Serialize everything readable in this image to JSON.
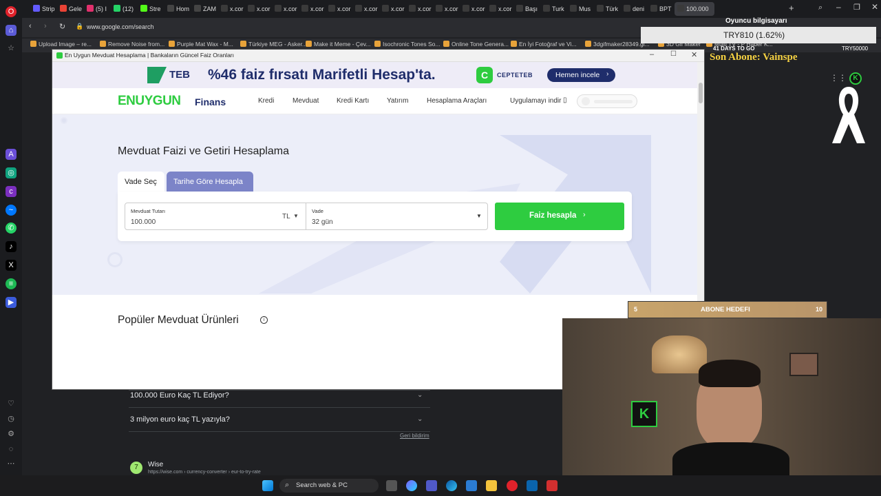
{
  "browser": {
    "tabs": [
      "Strip",
      "Gele",
      "(5) I",
      "(12)",
      "Stre",
      "Hom",
      "ZAM",
      "x.cor",
      "x.cor",
      "x.cor",
      "x.cor",
      "x.cor",
      "x.cor",
      "x.cor",
      "x.cor",
      "x.cor",
      "x.cor",
      "x.cor",
      "Başı",
      "Turk",
      "Mus",
      "Türk",
      "deni",
      "BPT",
      "100.000"
    ],
    "url": "www.google.com/search",
    "bookmarks": [
      "Upload Image – re...",
      "Remove Noise from...",
      "Purple Mat Wax - M...",
      "Türkiye MEG - Asker...",
      "Make it Meme - Çev...",
      "Isochronic Tones So...",
      "Online Tone Genera...",
      "En İyi Fotoğraf ve Vi...",
      "3dgifmaker28349.gi...",
      "3D Gif Maker",
      "Multi TV - P Haber K..."
    ]
  },
  "popup": {
    "title": "En Uygun Mevduat Hesaplama | Bankaların Güncel Faiz Oranları",
    "banner": {
      "bank": "TEB",
      "text": "%46 faiz fırsatı Marifetli Hesap'ta.",
      "brand": "CEPTETEB",
      "cta": "Hemen incele"
    },
    "nav": {
      "logo_main": "ENUYGUN",
      "logo_sub": "Finans",
      "links": [
        "Kredi",
        "Mevduat",
        "Kredi Kartı",
        "Yatırım",
        "Hesaplama Araçları"
      ],
      "app": "Uygulamayı indir"
    },
    "hero": {
      "title": "Mevduat Faizi ve Getiri Hesaplama",
      "tab_active": "Vade Seç",
      "tab_other": "Tarihe Göre Hesapla",
      "amount_label": "Mevduat Tutarı",
      "amount_value": "100.000",
      "currency": "TL",
      "term_label": "Vade",
      "term_value": "32 gün",
      "button": "Faiz hesapla"
    },
    "popular_title": "Popüler Mevduat Ürünleri"
  },
  "google": {
    "faq": [
      "100.000 Euro Kaç TL Ediyor?",
      "3 milyon euro kaç TL yazıyla?"
    ],
    "feedback": "Geri bildirim",
    "result_site": "Wise",
    "result_url": "https://wise.com › currency-converter › eur-to-try-rate"
  },
  "overlay": {
    "pc_label": "Oyuncu bilgisayarı",
    "ticker": "TRY810 (1.62%)",
    "countdown": "41 DAYS TO GO",
    "try_label": "TRY50000",
    "last_sub": "Son Abone: Vainspe",
    "goal_start": "5",
    "goal_label": "ABONE HEDEFI",
    "goal_end": "10"
  },
  "taskbar": {
    "search": "Search web & PC"
  },
  "colors": {
    "enuygun_green": "#2ecc40",
    "navy": "#1f2d6b",
    "tab_purple": "#7c84c8"
  }
}
